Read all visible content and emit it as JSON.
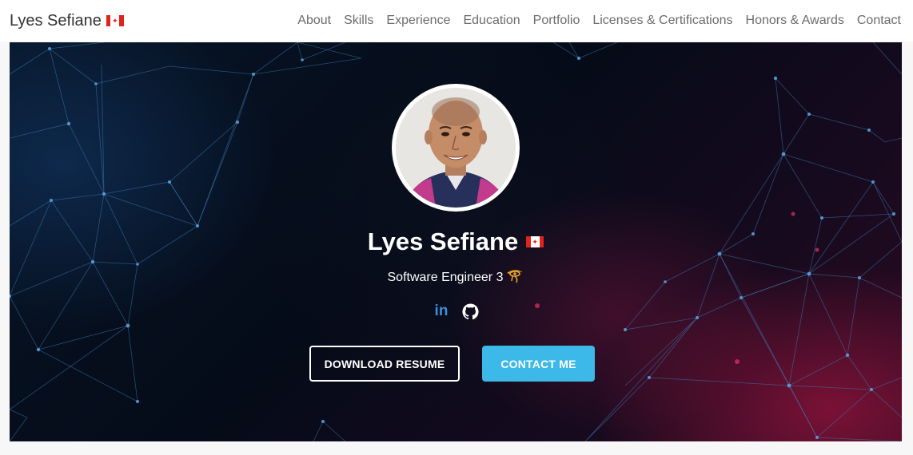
{
  "navbar": {
    "brand": "Lyes Sefiane",
    "links": [
      "About",
      "Skills",
      "Experience",
      "Education",
      "Portfolio",
      "Licenses & Certifications",
      "Honors & Awards",
      "Contact"
    ]
  },
  "hero": {
    "name": "Lyes Sefiane",
    "title": "Software Engineer 3",
    "socials": {
      "linkedin": "in"
    },
    "buttons": {
      "download": "DOWNLOAD RESUME",
      "contact": "CONTACT ME"
    }
  },
  "icons": {
    "brand_flag": "canada-flag-icon",
    "name_flag": "canada-flag-icon",
    "title_emblem": "eye-of-horus-icon",
    "linkedin": "linkedin-icon",
    "github": "github-icon"
  },
  "colors": {
    "accent": "#3cb9e8",
    "linkedin": "#3b8fd6",
    "flag_red": "#e2231a"
  }
}
